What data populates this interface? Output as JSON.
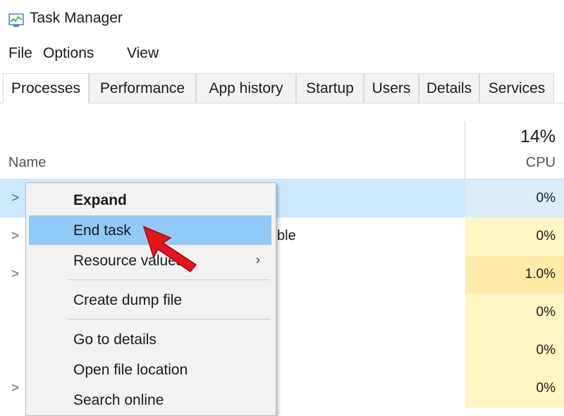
{
  "window": {
    "title": "Task Manager",
    "icon": "task-manager-icon"
  },
  "menu": {
    "items": [
      "File",
      "Options",
      "View"
    ]
  },
  "tabs": [
    "Processes",
    "Performance",
    "App history",
    "Startup",
    "Users",
    "Details",
    "Services"
  ],
  "header": {
    "name_label": "Name",
    "cpu_total": "14%",
    "cpu_label": "CPU"
  },
  "rows": [
    {
      "text": "",
      "cpu": "0%",
      "has_chevron": true
    },
    {
      "text": "ble",
      "cpu": "0%",
      "has_chevron": true
    },
    {
      "text": "",
      "cpu": "1.0%",
      "has_chevron": true
    },
    {
      "text": "",
      "cpu": "0%",
      "has_chevron": false
    },
    {
      "text": "",
      "cpu": "0%",
      "has_chevron": false
    },
    {
      "text": "",
      "cpu": "0%",
      "has_chevron": true
    }
  ],
  "context_menu": {
    "items": [
      {
        "label": "Expand"
      },
      {
        "label": "End task"
      },
      {
        "label": "Resource values"
      },
      {
        "label": "Create dump file"
      },
      {
        "label": "Go to details"
      },
      {
        "label": "Open file location"
      },
      {
        "label": "Search online"
      }
    ]
  },
  "colors": {
    "selected_row": "#cce8ff",
    "menu_highlight": "#91c9f7",
    "cpu_low": "#fff4c4",
    "cpu_mid": "#ffe9a8",
    "pointer": "#e8141b"
  }
}
